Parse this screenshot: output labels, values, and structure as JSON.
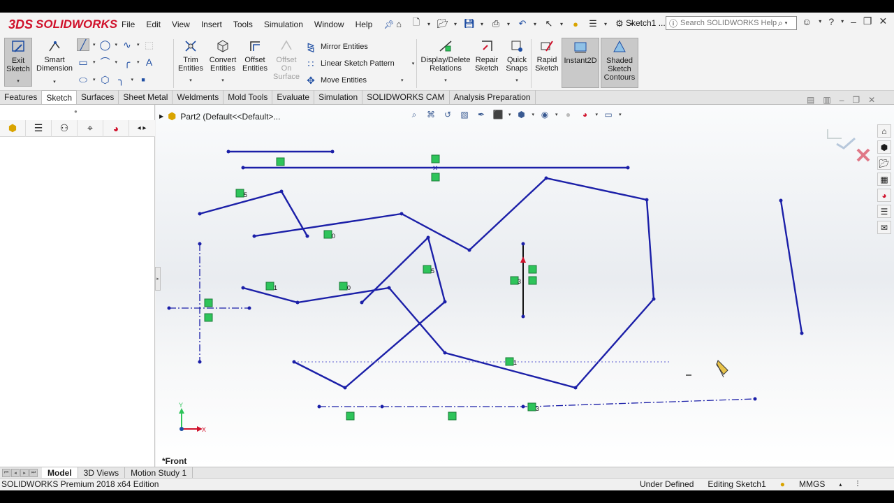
{
  "app": {
    "brand_prefix": "3DS",
    "brand_name": "SOLIDWORKS",
    "doc_title": "Sketch1 ...",
    "help_search_placeholder": "Search SOLIDWORKS Help"
  },
  "menus": [
    "File",
    "Edit",
    "View",
    "Insert",
    "Tools",
    "Simulation",
    "Window",
    "Help"
  ],
  "command_manager": {
    "exit_sketch": "Exit Sketch",
    "smart_dimension": "Smart Dimension",
    "trim_entities": "Trim Entities",
    "convert_entities": "Convert Entities",
    "offset_entities": "Offset Entities",
    "offset_on_surface": "Offset On Surface",
    "mirror_entities": "Mirror Entities",
    "linear_sketch_pattern": "Linear Sketch Pattern",
    "move_entities": "Move Entities",
    "display_delete_relations": "Display/Delete Relations",
    "repair_sketch": "Repair Sketch",
    "quick_snaps": "Quick Snaps",
    "rapid_sketch": "Rapid Sketch",
    "instant2d": "Instant2D",
    "shaded_sketch_contours": "Shaded Sketch Contours"
  },
  "tabs": [
    "Features",
    "Sketch",
    "Surfaces",
    "Sheet Metal",
    "Weldments",
    "Mold Tools",
    "Evaluate",
    "Simulation",
    "SOLIDWORKS CAM",
    "Analysis Preparation"
  ],
  "active_tab": "Sketch",
  "graphics": {
    "tree_path": "Part2  (Default<<Default>...",
    "view_label": "*Front",
    "triad_y": "Y",
    "triad_x": "X",
    "relation_labels": [
      "5",
      "0",
      "1",
      "0",
      "5",
      "3",
      "1",
      "3"
    ]
  },
  "bottom_tabs": [
    "Model",
    "3D Views",
    "Motion Study 1"
  ],
  "active_bottom_tab": "Model",
  "status": {
    "edition": "SOLIDWORKS Premium 2018 x64 Edition",
    "definition": "Under Defined",
    "mode": "Editing Sketch1",
    "units": "MMGS"
  },
  "colors": {
    "sketch_line": "#1b1fa8",
    "relation_badge": "#2ec45a",
    "brand_red": "#d0112b",
    "active_button": "#c9c9c9"
  }
}
